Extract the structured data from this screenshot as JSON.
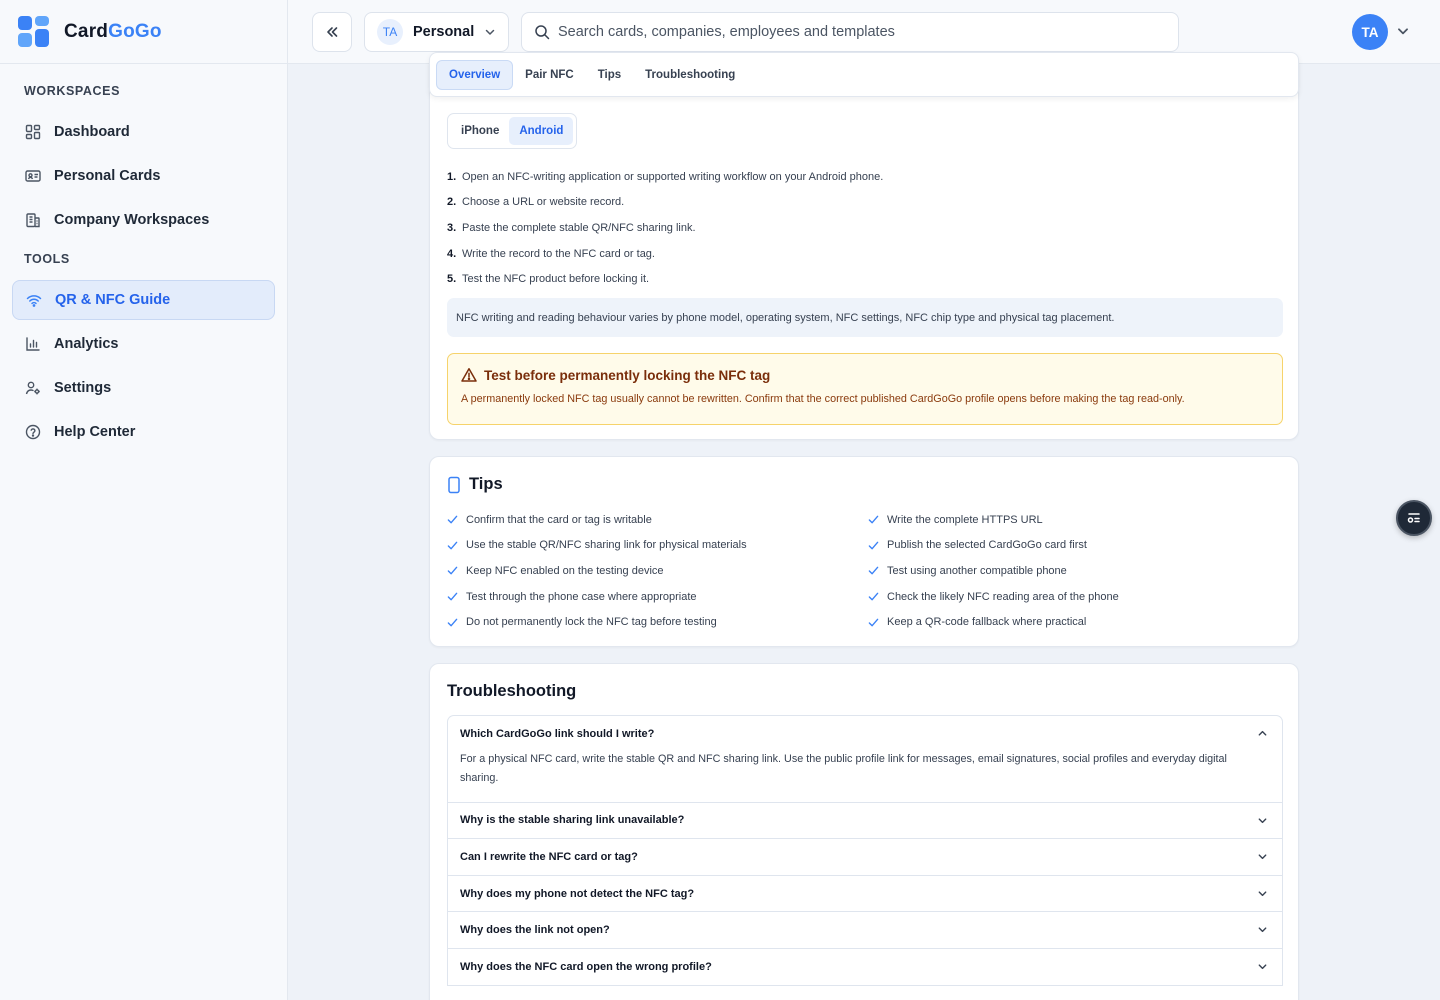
{
  "brand": {
    "name_a": "Card",
    "name_b": "GoGo"
  },
  "sidebar": {
    "sections": {
      "workspaces": "WORKSPACES",
      "tools": "TOOLS"
    },
    "items": [
      {
        "label": "Dashboard",
        "icon": "dashboard-icon"
      },
      {
        "label": "Personal Cards",
        "icon": "id-card-icon"
      },
      {
        "label": "Company Workspaces",
        "icon": "building-icon"
      },
      {
        "label": "QR & NFC Guide",
        "icon": "wifi-icon",
        "active": true
      },
      {
        "label": "Analytics",
        "icon": "bar-chart-icon"
      },
      {
        "label": "Settings",
        "icon": "user-settings-icon"
      },
      {
        "label": "Help Center",
        "icon": "help-circle-icon"
      }
    ]
  },
  "topbar": {
    "collapse_icon": "chevrons-left-icon",
    "workspace": {
      "initials": "TA",
      "name": "Personal"
    },
    "search": {
      "placeholder": "Search cards, companies, employees and templates",
      "value": ""
    },
    "user": {
      "initials": "TA"
    }
  },
  "tabs": [
    "Overview",
    "Pair NFC",
    "Tips",
    "Troubleshooting"
  ],
  "overview": {
    "platforms": [
      "iPhone",
      "Android"
    ],
    "selected_platform": "Android",
    "steps": [
      "Open an NFC-writing application or supported writing workflow on your Android phone.",
      "Choose a URL or website record.",
      "Paste the complete stable QR/NFC sharing link.",
      "Write the record to the NFC card or tag.",
      "Test the NFC product before locking it."
    ],
    "note": "NFC writing and reading behaviour varies by phone model, operating system, NFC settings, NFC chip type and physical tag placement.",
    "warning": {
      "title": "Test before permanently locking the NFC tag",
      "text": "A permanently locked NFC tag usually cannot be rewritten. Confirm that the correct published CardGoGo profile opens before making the tag read-only."
    }
  },
  "tips": {
    "title": "Tips",
    "left": [
      "Confirm that the card or tag is writable",
      "Use the stable QR/NFC sharing link for physical materials",
      "Keep NFC enabled on the testing device",
      "Test through the phone case where appropriate",
      "Do not permanently lock the NFC tag before testing"
    ],
    "right": [
      "Write the complete HTTPS URL",
      "Publish the selected CardGoGo card first",
      "Test using another compatible phone",
      "Check the likely NFC reading area of the phone",
      "Keep a QR-code fallback where practical"
    ]
  },
  "troubleshooting": {
    "title": "Troubleshooting",
    "items": [
      {
        "q": "Which CardGoGo link should I write?",
        "a": "For a physical NFC card, write the stable QR and NFC sharing link. Use the public profile link for messages, email signatures, social profiles and everyday digital sharing.",
        "open": true
      },
      {
        "q": "Why is the stable sharing link unavailable?"
      },
      {
        "q": "Can I rewrite the NFC card or tag?"
      },
      {
        "q": "Why does my phone not detect the NFC tag?"
      },
      {
        "q": "Why does the link not open?"
      },
      {
        "q": "Why does the NFC card open the wrong profile?"
      }
    ]
  },
  "colors": {
    "accent": "#3b82f6",
    "warning_bg": "#fffbea",
    "warning_border": "#f6d36b"
  }
}
